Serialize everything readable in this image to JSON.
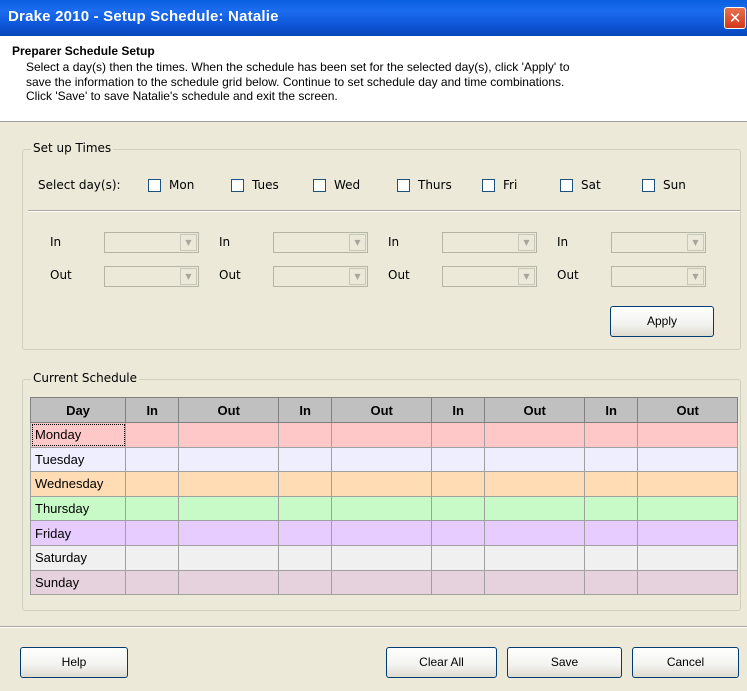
{
  "window": {
    "title": "Drake 2010 - Setup Schedule: Natalie",
    "close_glyph": "✕"
  },
  "header": {
    "title": "Preparer Schedule Setup",
    "lines": [
      "Select a day(s) then the times.  When the schedule has been set for the selected day(s), click 'Apply' to",
      "save the information to the schedule grid below.  Continue to set schedule day and time combinations.",
      "Click 'Save' to save Natalie's schedule and exit the screen."
    ]
  },
  "setup_times": {
    "label": "Set up Times",
    "select_days_label": "Select day(s):",
    "days": [
      "Mon",
      "Tues",
      "Wed",
      "Thurs",
      "Fri",
      "Sat",
      "Sun"
    ],
    "in_label": "In",
    "out_label": "Out",
    "apply_label": "Apply"
  },
  "current_schedule": {
    "label": "Current Schedule",
    "columns": [
      "Day",
      "In",
      "Out",
      "In",
      "Out",
      "In",
      "Out",
      "In",
      "Out"
    ],
    "rows": [
      {
        "day": "Monday",
        "color": "#ffc8c8"
      },
      {
        "day": "Tuesday",
        "color": "#eeeeff"
      },
      {
        "day": "Wednesday",
        "color": "#ffdcb4"
      },
      {
        "day": "Thursday",
        "color": "#c8fac8"
      },
      {
        "day": "Friday",
        "color": "#e6ccff"
      },
      {
        "day": "Saturday",
        "color": "#f0f0f0"
      },
      {
        "day": "Sunday",
        "color": "#e6d2dc"
      }
    ]
  },
  "footer": {
    "help_label": "Help",
    "clear_all_label": "Clear All",
    "save_label": "Save",
    "cancel_label": "Cancel"
  }
}
